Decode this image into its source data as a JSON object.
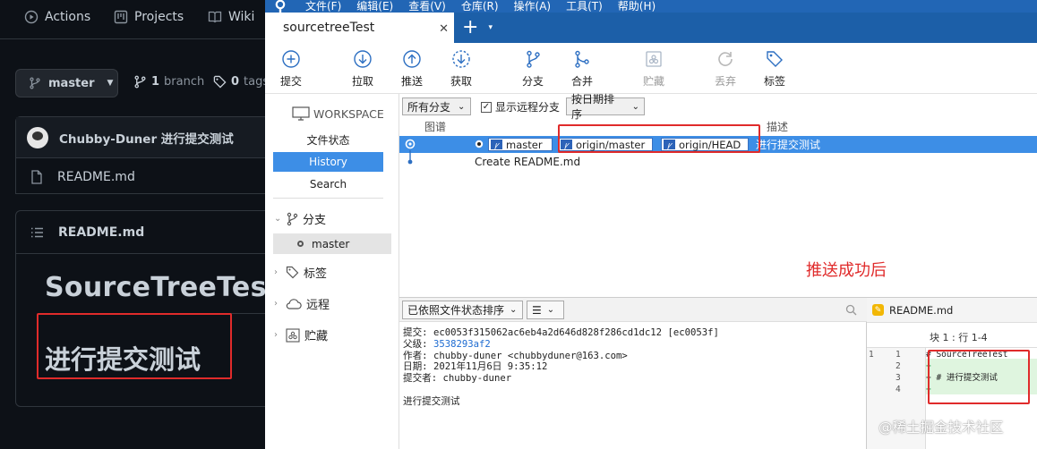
{
  "github": {
    "nav": {
      "actions": "Actions",
      "projects": "Projects",
      "wiki": "Wiki"
    },
    "branch_button": "master",
    "branch_count": "1",
    "branch_word": "branch",
    "tags_count": "0",
    "tags_word": "tags",
    "commit": {
      "author_message": "Chubby-Duner 进行提交测试"
    },
    "file": "README.md",
    "readme": {
      "header": "README.md",
      "h1": "SourceTreeTest",
      "h2": "进行提交测试"
    }
  },
  "sourcetree": {
    "menu": [
      "文件(F)",
      "编辑(E)",
      "查看(V)",
      "仓库(R)",
      "操作(A)",
      "工具(T)",
      "帮助(H)"
    ],
    "tab": {
      "label": "sourcetreeTest",
      "close": "✕",
      "add": "+",
      "dropdown": "▾"
    },
    "toolbar": {
      "commit": "提交",
      "pull": "拉取",
      "push": "推送",
      "fetch": "获取",
      "branch": "分支",
      "merge": "合并",
      "stash": "贮藏",
      "discard": "丢弃",
      "tag": "标签"
    },
    "sidebar": {
      "workspace": "WORKSPACE",
      "file_status": "文件状态",
      "history": "History",
      "search": "Search",
      "branches": "分支",
      "branch_master": "master",
      "tags": "标签",
      "remotes": "远程",
      "stashes": "贮藏"
    },
    "filters": {
      "all_branches": "所有分支",
      "show_remote": "显示远程分支",
      "sort_date": "按日期排序"
    },
    "columns": {
      "graph": "图谱",
      "description": "描述"
    },
    "history": {
      "row1": {
        "ref_local": "master",
        "ref_origin_master": "origin/master",
        "ref_origin_head": "origin/HEAD",
        "message": "进行提交测试"
      },
      "row2": {
        "message": "Create README.md"
      }
    },
    "annotation": "推送成功后",
    "detail": {
      "sort_label": "已依照文件状态排序",
      "commit_line": "提交: ec0053f315062ac6eb4a2d646d828f286cd1dc12 [ec0053f]",
      "parent_label": "父级:",
      "parent_hash": "3538293af2",
      "author_line": "作者: chubby-duner <chubbyduner@163.com>",
      "date_line": "日期: 2021年11月6日 9:35:12",
      "committer_line": "提交者: chubby-duner",
      "message": "进行提交测试"
    },
    "diff": {
      "file": "README.md",
      "hunk": "块 1 : 行 1-4",
      "lines": [
        {
          "old": "1",
          "new": "1",
          "text": "  # SourceTreeTest"
        },
        {
          "old": "",
          "new": "2",
          "text": "+"
        },
        {
          "old": "",
          "new": "3",
          "text": "+ # 进行提交测试"
        },
        {
          "old": "",
          "new": "4",
          "text": "+"
        }
      ]
    }
  },
  "watermark": "@稀土掘金技术社区",
  "colors": {
    "accent": "#3d8ee6",
    "titlebar": "#2266b5",
    "highlight": "#e02b2b",
    "diff_add": "#dff5df"
  }
}
